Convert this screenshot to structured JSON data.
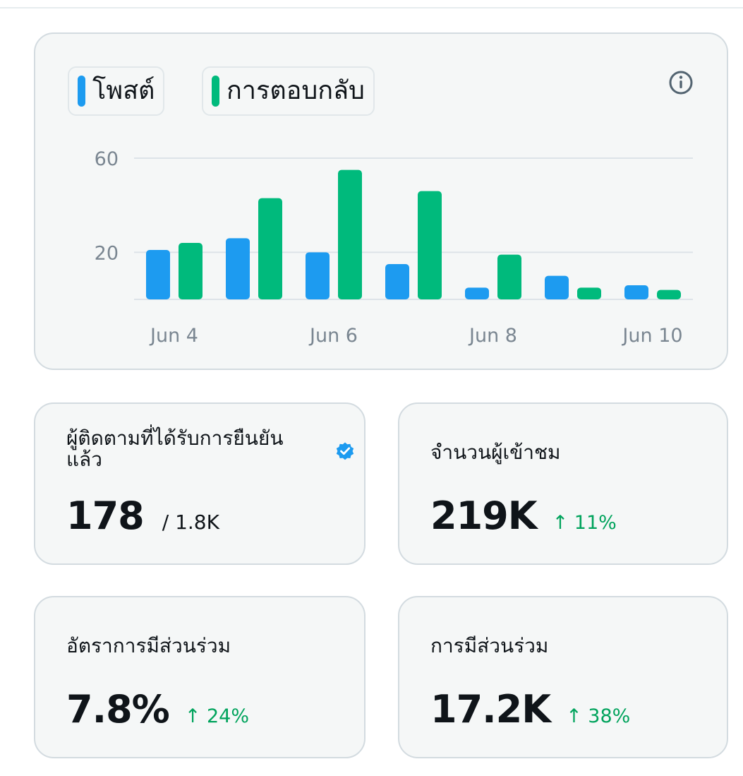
{
  "colors": {
    "posts": "#1d9bf0",
    "replies": "#00ba7c",
    "positive": "#00a35c",
    "verified": "#1d9bf0"
  },
  "legend": {
    "posts_label": "โพสต์",
    "replies_label": "การตอบกลับ",
    "info_icon": "info-circle-icon"
  },
  "chart_data": {
    "type": "bar",
    "categories": [
      "Jun 4",
      "Jun 5",
      "Jun 6",
      "Jun 7",
      "Jun 8",
      "Jun 9",
      "Jun 10"
    ],
    "x_tick_labels": [
      "Jun 4",
      "Jun 6",
      "Jun 8",
      "Jun 10"
    ],
    "y_ticks": [
      20,
      60
    ],
    "ylim": [
      0,
      60
    ],
    "grid": true,
    "legend_position": "top-left",
    "series": [
      {
        "name": "โพสต์",
        "color": "#1d9bf0",
        "values": [
          21,
          26,
          20,
          15,
          5,
          10,
          6
        ]
      },
      {
        "name": "การตอบกลับ",
        "color": "#00ba7c",
        "values": [
          24,
          43,
          55,
          46,
          19,
          5,
          4
        ]
      }
    ]
  },
  "stats": [
    {
      "title": "ผู้ติดตามที่ได้รับการยืนยันแล้ว",
      "value": "178",
      "sub": "/ 1.8K",
      "icon": "verified-badge-icon"
    },
    {
      "title": "จำนวนผู้เข้าชม",
      "value": "219K",
      "change": "↑ 11%"
    },
    {
      "title": "อัตราการมีส่วนร่วม",
      "value": "7.8%",
      "change": "↑ 24%"
    },
    {
      "title": "การมีส่วนร่วม",
      "value": "17.2K",
      "change": "↑ 38%"
    }
  ]
}
